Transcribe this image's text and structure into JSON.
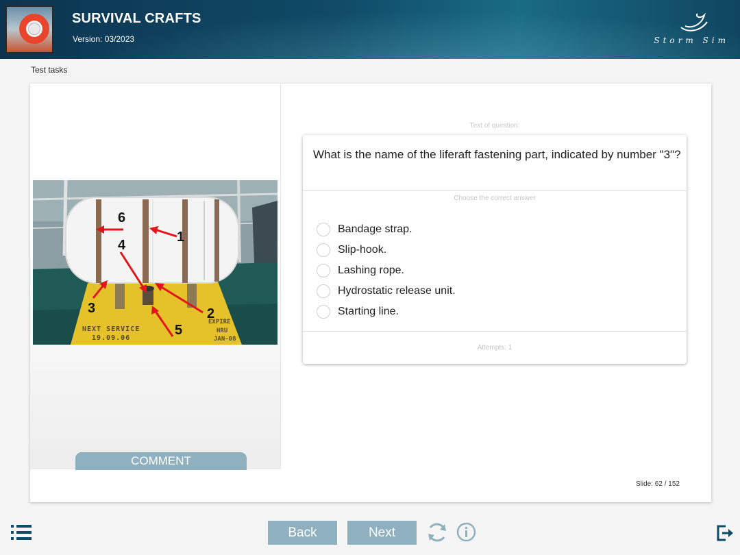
{
  "header": {
    "title": "SURVIVAL CRAFTS",
    "version": "Version: 03/2023",
    "brand": "Storm Sim"
  },
  "breadcrumb": "Test tasks",
  "question": {
    "caption": "Text of question:",
    "text": "What is the name of the liferaft fastening part, indicated by number \"3\"?",
    "instruction": "Choose the correct answer",
    "answers": [
      "Bandage strap.",
      "Slip-hook.",
      "Lashing rope.",
      "Hydrostatic release unit.",
      "Starting line."
    ],
    "attempts": "Attempts: 1"
  },
  "image": {
    "labels": [
      "6",
      "1",
      "4",
      "3",
      "2",
      "5"
    ],
    "stencil": [
      "NEXT SERVICE",
      "19.09.06",
      "EXPIRE",
      "HRU",
      "JAN-08"
    ]
  },
  "comment_label": "COMMENT",
  "slide": "Slide:  62 / 152",
  "nav": {
    "back": "Back",
    "next": "Next"
  },
  "icons": {
    "menu": "list-menu-icon",
    "refresh": "refresh-icon",
    "info": "info-icon",
    "exit": "exit-icon"
  },
  "colors": {
    "button": "#8fb0be",
    "header": "#0f4a66",
    "arrow": "#e0161b"
  }
}
